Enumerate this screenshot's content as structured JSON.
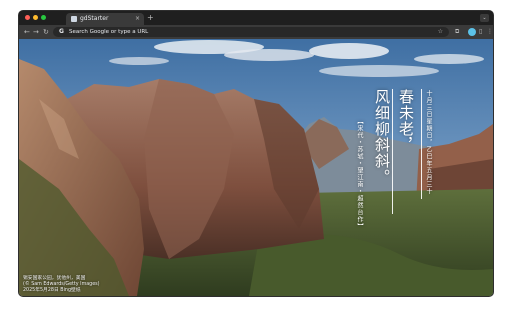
{
  "colors": {
    "close": "#ff5f57",
    "minimize": "#febc2e",
    "zoom": "#28c840",
    "profile": "#5cc2e8"
  },
  "tab": {
    "title": "gdStarter",
    "close_icon": "×",
    "new_tab_icon": "+",
    "menu_icon": "⌄"
  },
  "toolbar": {
    "back_icon": "←",
    "forward_icon": "→",
    "reload_icon": "↻",
    "google_icon": "G",
    "omnibox_placeholder": "Search Google or type a URL",
    "bookmark_icon": "☆",
    "extension_icon": "⧉",
    "sidebar_icon": "▯",
    "menu_icon": "⋮"
  },
  "poem": {
    "date": "十月三日星期日，乙巳年五月三十",
    "line_1": "春未老，",
    "line_2": "风细柳斜斜。",
    "source": "【宋代・苏轼・望江南・超然台作】"
  },
  "credit": {
    "line_1": "锡安国家公园，犹他州，美国",
    "line_2": "(© Sam Edwards/Getty Images)",
    "line_3": "2025年5月28日 Bing壁纸"
  }
}
